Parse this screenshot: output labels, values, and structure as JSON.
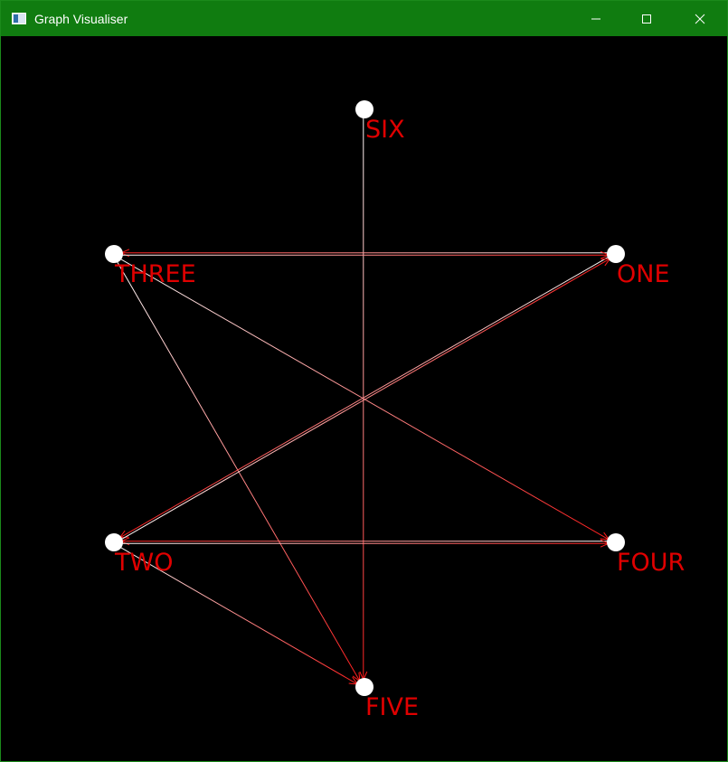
{
  "window": {
    "title": "Graph Visualiser",
    "titlebar_color": "#107c10",
    "controls": {
      "minimize_icon": "minimize-icon",
      "maximize_icon": "maximize-icon",
      "close_icon": "close-icon"
    }
  },
  "graph": {
    "node_color": "#ffffff",
    "label_color": "#e00000",
    "nodes": [
      {
        "id": "SIX",
        "label": "SIX"
      },
      {
        "id": "THREE",
        "label": "THREE"
      },
      {
        "id": "ONE",
        "label": "ONE"
      },
      {
        "id": "TWO",
        "label": "TWO"
      },
      {
        "id": "FOUR",
        "label": "FOUR"
      },
      {
        "id": "FIVE",
        "label": "FIVE"
      }
    ],
    "edges": [
      {
        "from": "SIX",
        "to": "FIVE"
      },
      {
        "from": "ONE",
        "to": "THREE"
      },
      {
        "from": "THREE",
        "to": "ONE"
      },
      {
        "from": "THREE",
        "to": "FOUR"
      },
      {
        "from": "THREE",
        "to": "FIVE"
      },
      {
        "from": "ONE",
        "to": "TWO"
      },
      {
        "from": "TWO",
        "to": "ONE"
      },
      {
        "from": "FOUR",
        "to": "TWO"
      },
      {
        "from": "TWO",
        "to": "FOUR"
      },
      {
        "from": "TWO",
        "to": "FIVE"
      }
    ]
  }
}
